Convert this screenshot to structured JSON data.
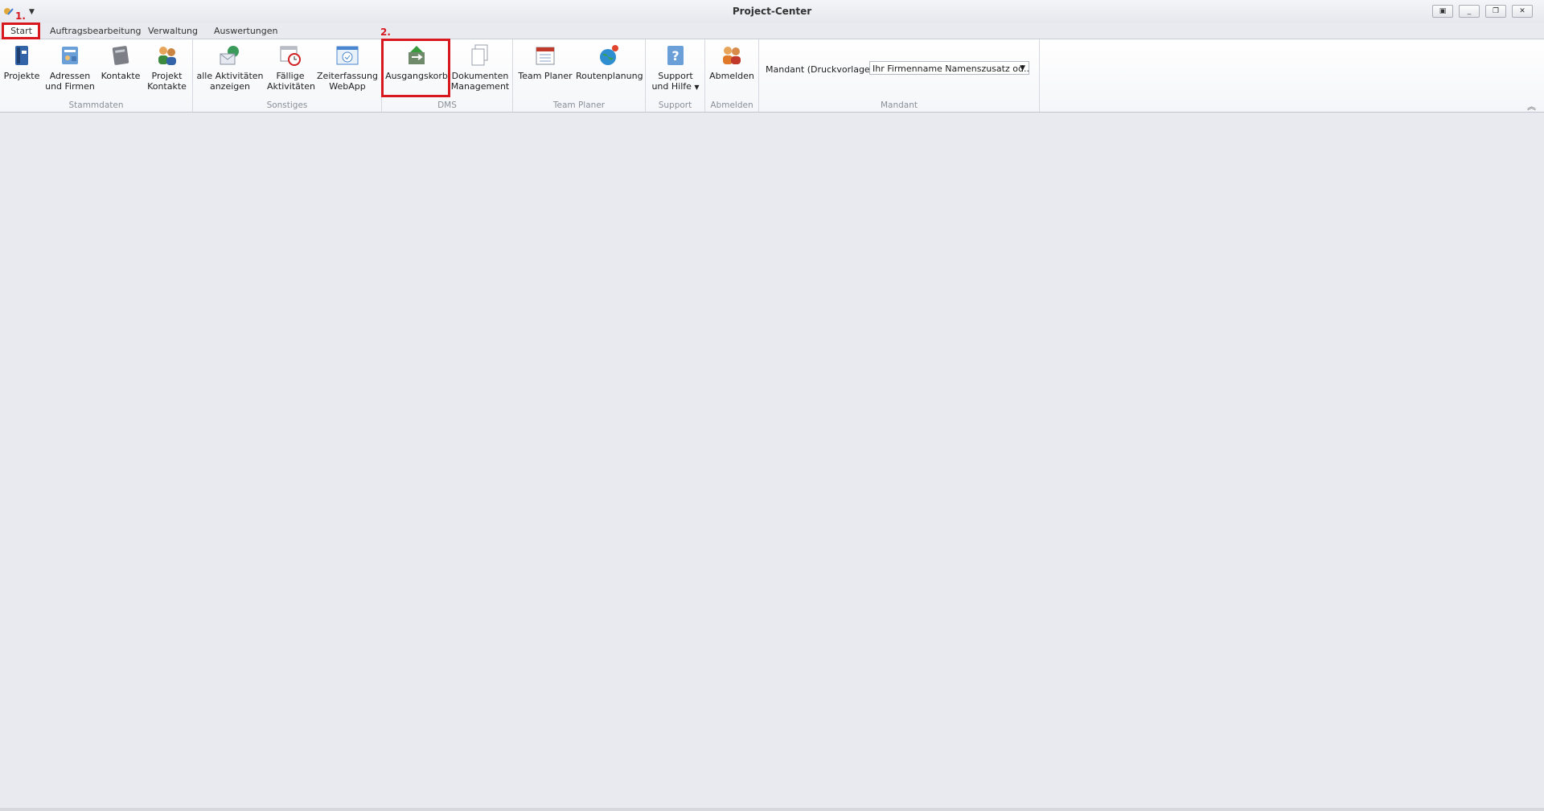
{
  "window": {
    "title": "Project-Center"
  },
  "tabs": [
    "Start",
    "Auftragsbearbeitung",
    "Verwaltung",
    "Auswertungen"
  ],
  "groups": {
    "stammdaten": {
      "label": "Stammdaten",
      "buttons": [
        {
          "line1": "Projekte",
          "line2": ""
        },
        {
          "line1": "Adressen",
          "line2": "und Firmen"
        },
        {
          "line1": "Kontakte",
          "line2": ""
        },
        {
          "line1": "Projekt",
          "line2": "Kontakte"
        }
      ]
    },
    "sonstiges": {
      "label": "Sonstiges",
      "buttons": [
        {
          "line1": "alle Aktivitäten",
          "line2": "anzeigen"
        },
        {
          "line1": "Fällige",
          "line2": "Aktivitäten"
        },
        {
          "line1": "Zeiterfassung",
          "line2": "WebApp"
        }
      ]
    },
    "dms": {
      "label": "DMS",
      "buttons": [
        {
          "line1": "Ausgangskorb",
          "line2": ""
        },
        {
          "line1": "Dokumenten",
          "line2": "Management"
        }
      ]
    },
    "team_planer": {
      "label": "Team Planer",
      "buttons": [
        {
          "line1": "Team Planer",
          "line2": ""
        },
        {
          "line1": "Routenplanung",
          "line2": ""
        }
      ]
    },
    "support": {
      "label": "Support",
      "buttons": [
        {
          "line1": "Support",
          "line2": "und Hilfe"
        }
      ]
    },
    "abmelden": {
      "label": "Abmelden",
      "buttons": [
        {
          "line1": "Abmelden",
          "line2": ""
        }
      ]
    },
    "mandant": {
      "label": "Mandant",
      "field_label": "Mandant (Druckvorlagen):",
      "selected": "Ihr Firmenname Namenszusatz od..."
    }
  },
  "annotations": [
    "1.",
    "2."
  ],
  "colors": {
    "annotation": "#d7191f",
    "background": "#e9eaef"
  }
}
